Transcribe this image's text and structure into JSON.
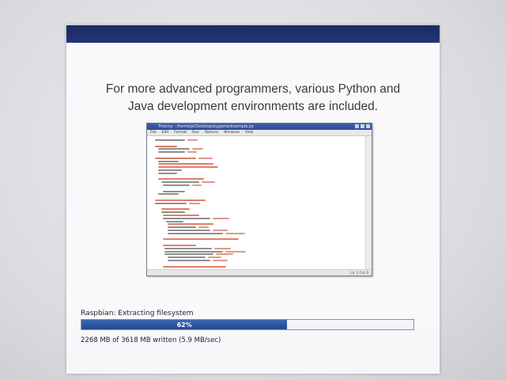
{
  "slide": {
    "caption_line1": "For more advanced programmers, various Python and",
    "caption_line2": "Java development environments are included.",
    "ide_screenshot": {
      "title": "Thonny - /home/pi/Desktop/pygame/example.py",
      "menu": [
        "File",
        "Edit",
        "Format",
        "Run",
        "Options",
        "Windows",
        "Help"
      ],
      "cursor_position": "Ln: 1 Col: 0"
    }
  },
  "install": {
    "status": "Raspbian: Extracting filesystem",
    "progress_percent": 62,
    "progress_label": "62%",
    "written": "2268 MB of 3618 MB written (5.9 MB/sec)"
  },
  "colors": {
    "title_strip": "#1b2a63",
    "progress_fill": "#2b55a0",
    "code_keyword": "#c04a2a",
    "code_plain": "#333333",
    "code_comment": "#d14a2a"
  }
}
